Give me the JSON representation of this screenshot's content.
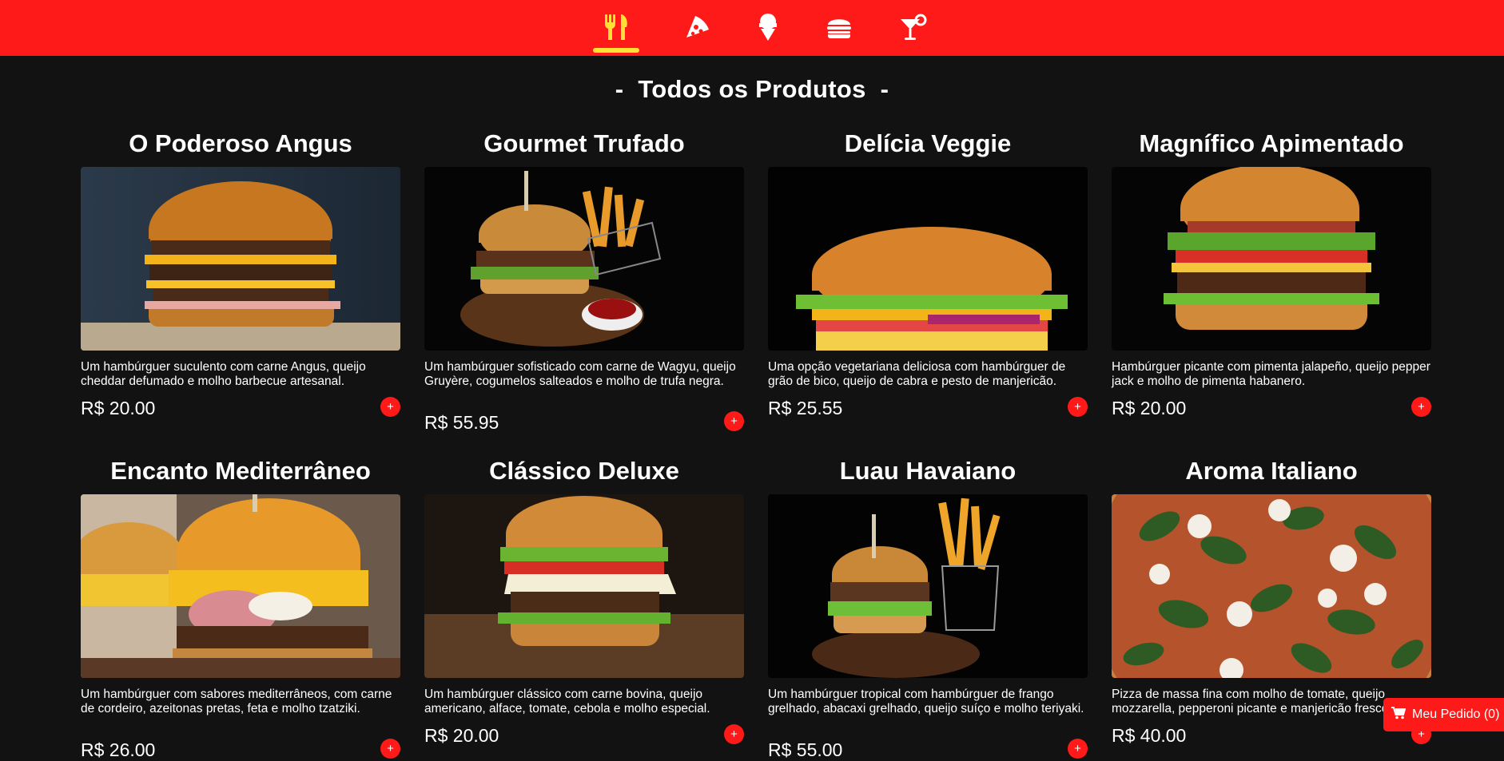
{
  "nav": {
    "items": [
      {
        "icon": "utensils-icon",
        "active": true
      },
      {
        "icon": "pizza-icon",
        "active": false
      },
      {
        "icon": "ice-cream-icon",
        "active": false
      },
      {
        "icon": "burger-icon",
        "active": false
      },
      {
        "icon": "cocktail-icon",
        "active": false
      }
    ],
    "colors": {
      "bar": "#ff1a1a",
      "icon": "#ffffff",
      "active_icon": "#ffe135"
    }
  },
  "section": {
    "dash_left": "-",
    "title": "Todos os Produtos",
    "dash_right": "-"
  },
  "products": [
    {
      "name": "O Poderoso Angus",
      "description": "Um hambúrguer suculento com carne Angus, queijo cheddar defumado e molho barbecue artesanal.",
      "price": "R$ 20.00",
      "add_label": "+",
      "image": "angus-burger-photo"
    },
    {
      "name": "Gourmet Trufado",
      "description": "Um hambúrguer sofisticado com carne de Wagyu, queijo Gruyère, cogumelos salteados e molho de trufa negra.",
      "price": "R$ 55.95",
      "add_label": "+",
      "image": "truffle-burger-fries-photo"
    },
    {
      "name": "Delícia Veggie",
      "description": "Uma opção vegetariana deliciosa com hambúrguer de grão de bico, queijo de cabra e pesto de manjericão.",
      "price": "R$ 25.55",
      "add_label": "+",
      "image": "veggie-burger-photo"
    },
    {
      "name": "Magnífico Apimentado",
      "description": "Hambúrguer picante com pimenta jalapeño, queijo pepper jack e molho de pimenta habanero.",
      "price": "R$ 20.00",
      "add_label": "+",
      "image": "spicy-burger-photo"
    },
    {
      "name": "Encanto Mediterrâneo",
      "description": "Um hambúrguer com sabores mediterrâneos, com carne de cordeiro, azeitonas pretas, feta e molho tzatziki.",
      "price": "R$ 26.00",
      "add_label": "+",
      "image": "mediterranean-burger-photo"
    },
    {
      "name": "Clássico Deluxe",
      "description": "Um hambúrguer clássico com carne bovina, queijo americano, alface, tomate, cebola e molho especial.",
      "price": "R$ 20.00",
      "add_label": "+",
      "image": "classic-burger-photo"
    },
    {
      "name": "Luau Havaiano",
      "description": "Um hambúrguer tropical com hambúrguer de frango grelhado, abacaxi grelhado, queijo suíço e molho teriyaki.",
      "price": "R$ 55.00",
      "add_label": "+",
      "image": "hawaiian-burger-fries-photo"
    },
    {
      "name": "Aroma Italiano",
      "description": "Pizza de massa fina com molho de tomate, queijo mozzarella, pepperoni picante e manjericão fresco.",
      "price": "R$ 40.00",
      "add_label": "+",
      "image": "italian-pizza-photo"
    }
  ],
  "cart": {
    "label": "Meu Pedido (0)",
    "icon": "cart-icon"
  }
}
